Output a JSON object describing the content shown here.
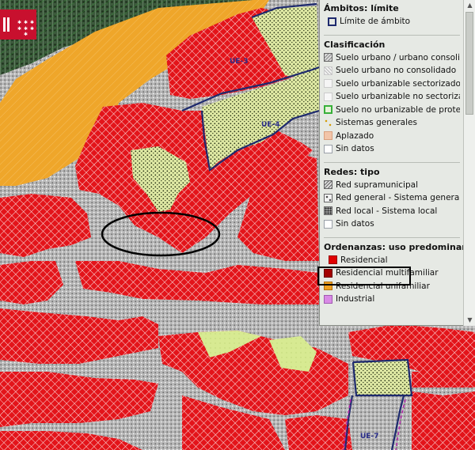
{
  "map": {
    "area_labels": {
      "ue_top": "UE-3",
      "ue_mid": "UE-4",
      "ue_bottom": "UE-7"
    }
  },
  "legend": {
    "ambitos": {
      "title": "Ámbitos: límite",
      "items": [
        {
          "label": "Límite de ámbito",
          "swatch": "outline-navy"
        }
      ]
    },
    "clasificacion": {
      "title": "Clasificación",
      "items": [
        {
          "label": "Suelo urbano / urbano consolidado",
          "swatch": "hatch-grey"
        },
        {
          "label": "Suelo urbano no consolidado",
          "swatch": "hatch-light"
        },
        {
          "label": "Suelo urbanizable sectorizado",
          "swatch": "dots-light"
        },
        {
          "label": "Suelo urbanizable no sectorizado",
          "swatch": "plain-light"
        },
        {
          "label": "Suelo no urbanizable de protección",
          "swatch": "outline-green"
        },
        {
          "label": "Sistemas generales",
          "swatch": "dots-yellow"
        },
        {
          "label": "Aplazado",
          "swatch": "fill-peach"
        },
        {
          "label": "Sin datos",
          "swatch": "fill-white"
        }
      ]
    },
    "redes": {
      "title": "Redes: tipo",
      "items": [
        {
          "label": "Red supramunicipal",
          "swatch": "hatch-grey"
        },
        {
          "label": "Red general - Sistema general",
          "swatch": "dots-grey"
        },
        {
          "label": "Red local - Sistema local",
          "swatch": "dots-dark"
        },
        {
          "label": "Sin datos",
          "swatch": "fill-white"
        }
      ]
    },
    "ordenanzas": {
      "title": "Ordenanzas: uso predominante",
      "items": [
        {
          "label": "Residencial",
          "swatch": "fill-red"
        },
        {
          "label": "Residencial multifamiliar",
          "swatch": "fill-darkred"
        },
        {
          "label": "Residencial unifamiliar",
          "swatch": "fill-orange"
        },
        {
          "label": "Industrial",
          "swatch": "fill-violet"
        }
      ]
    }
  },
  "colors": {
    "residencial": "#e3141a",
    "unifamiliar": "#f0a82c",
    "suelo_verde": "#d9e89a",
    "red_viaria": "#b5b5b5",
    "limite_ambito": "#1e2a6e",
    "highlight": "#000000"
  },
  "icons": {
    "logo": "comunidad-de-madrid-logo",
    "scroll_up": "arrow-up",
    "scroll_down": "arrow-down"
  }
}
